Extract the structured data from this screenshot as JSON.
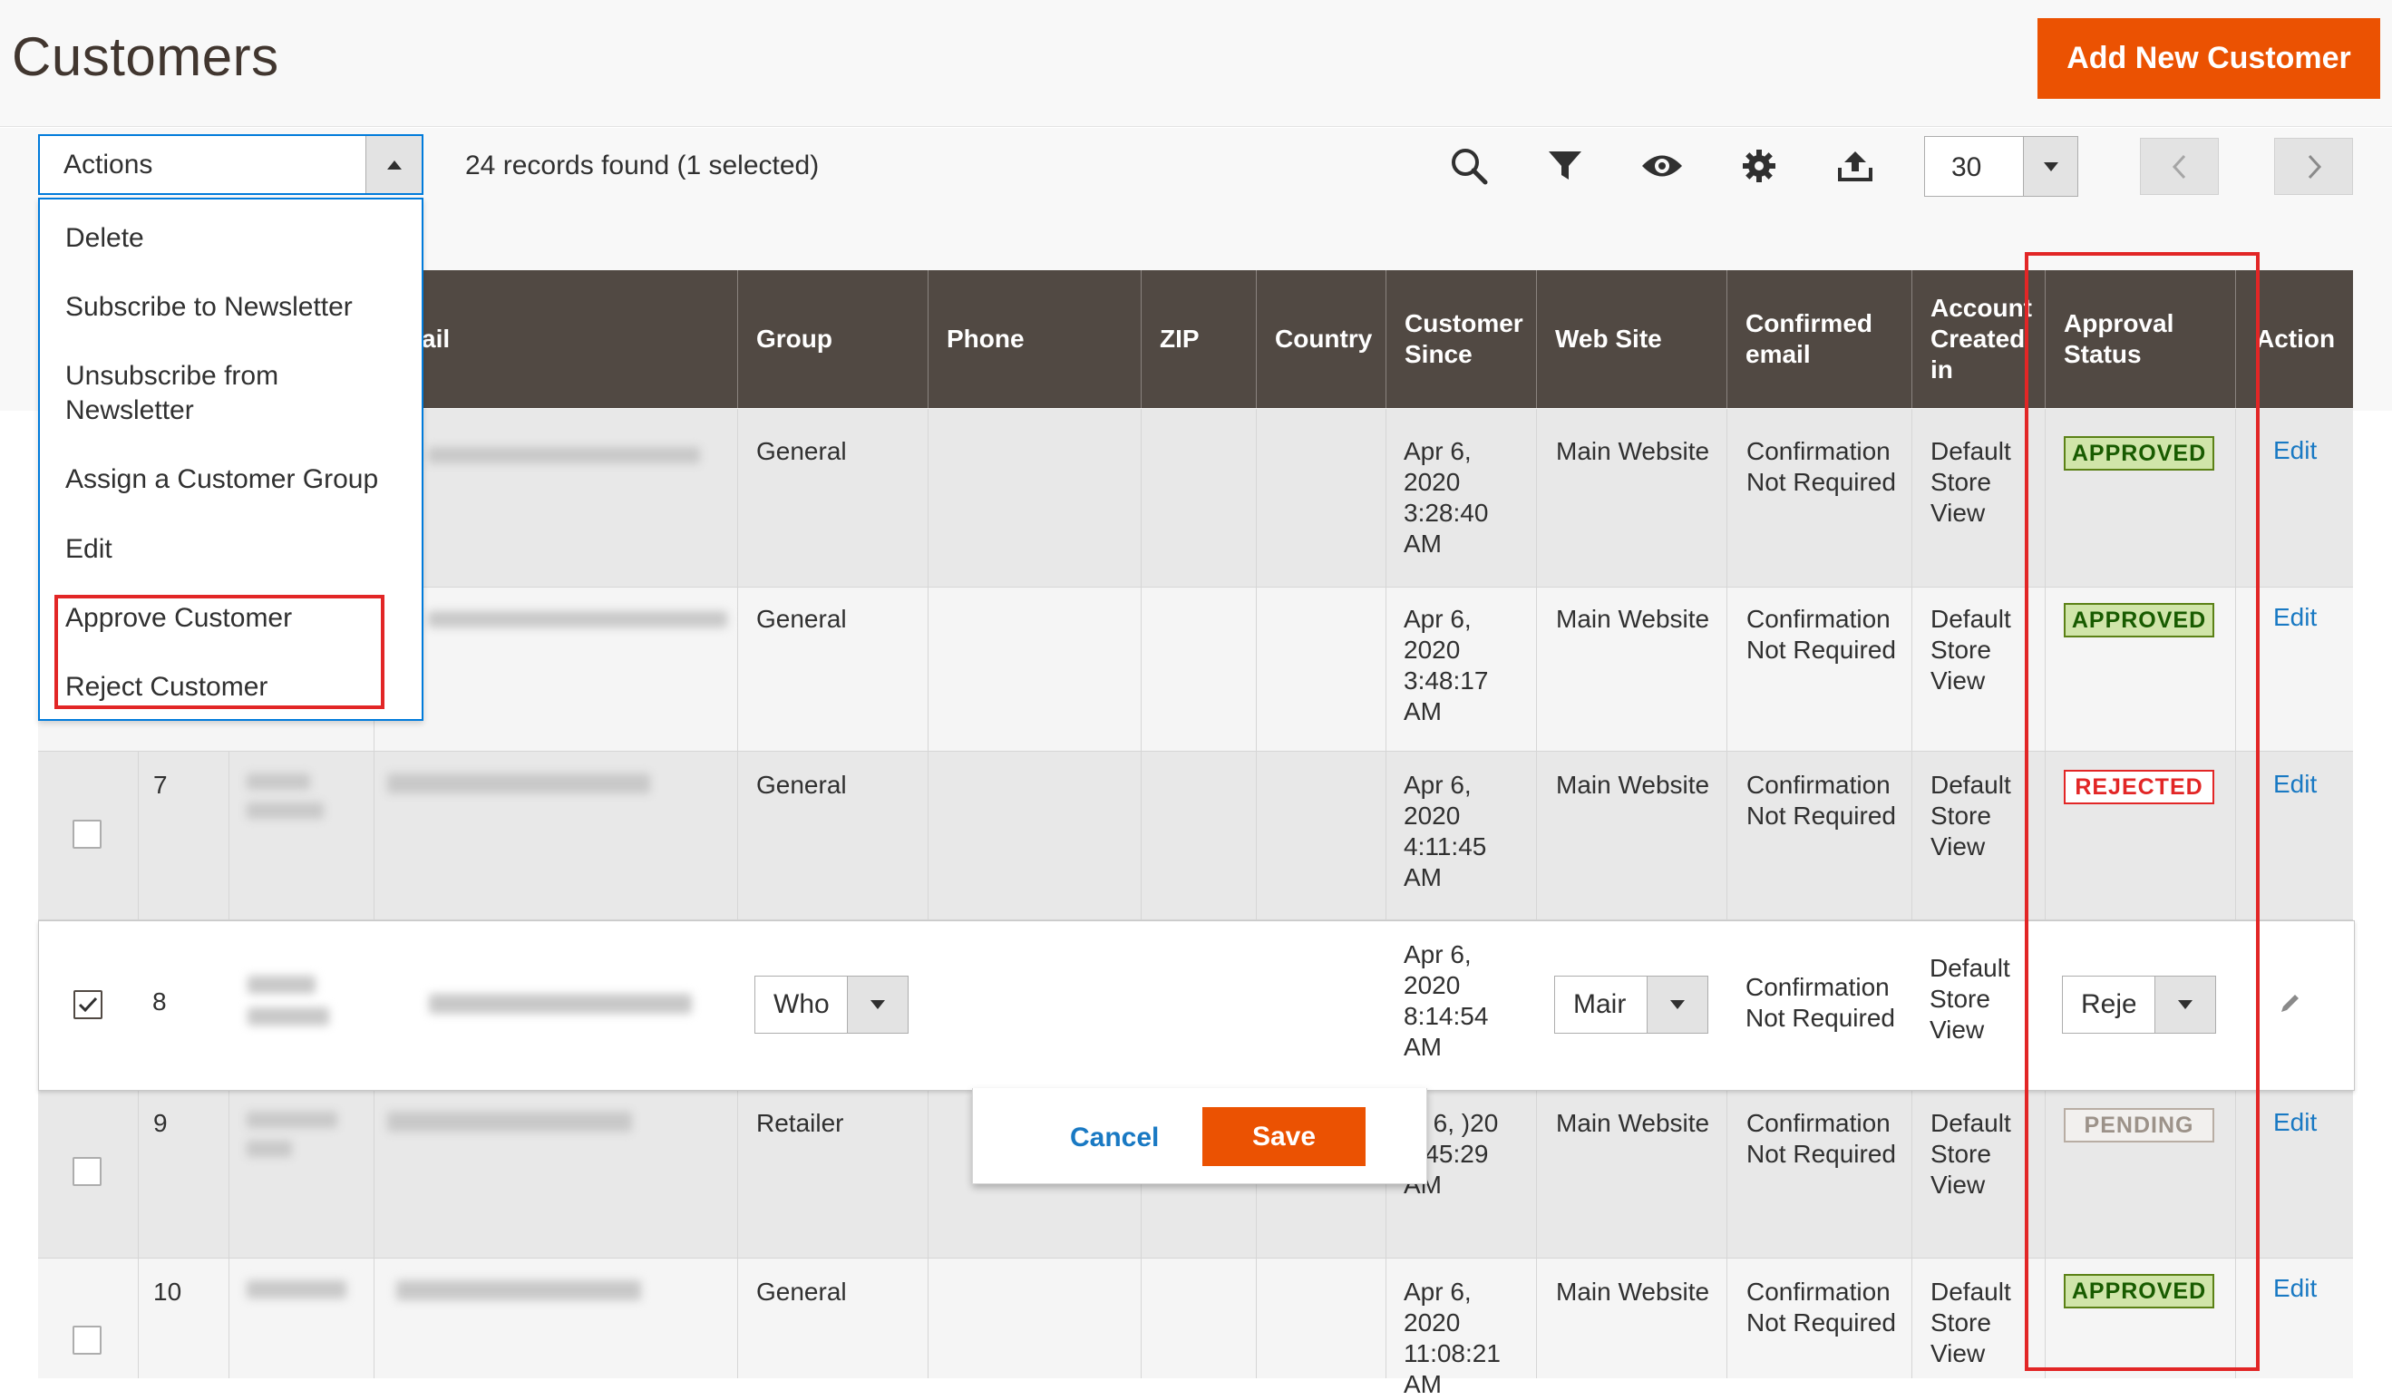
{
  "header": {
    "title": "Customers",
    "add_button": "Add New Customer"
  },
  "toolbar": {
    "actions_label": "Actions",
    "records_text": "24 records found (1 selected)",
    "per_page": "30",
    "icons": [
      "search-icon",
      "filter-icon",
      "eye-icon",
      "gear-icon",
      "export-icon"
    ]
  },
  "actions_menu": {
    "items": [
      "Delete",
      "Subscribe to Newsletter",
      "Unsubscribe from Newsletter",
      "Assign a Customer Group",
      "Edit",
      "Approve Customer",
      "Reject Customer"
    ]
  },
  "grid": {
    "columns": [
      "ail",
      "Group",
      "Phone",
      "ZIP",
      "Country",
      "Customer Since",
      "Web Site",
      "Confirmed email",
      "Account Created in",
      "Approval Status",
      "Action"
    ],
    "rows": [
      {
        "id": "",
        "group": "General",
        "since": "Apr 6, 2020 3:28:40 AM",
        "website": "Main Website",
        "confirmed": "Confirmation Not Required",
        "created_in": "Default Store View",
        "status": "APPROVED",
        "action": "Edit"
      },
      {
        "id": "",
        "group": "General",
        "since": "Apr 6, 2020 3:48:17 AM",
        "website": "Main Website",
        "confirmed": "Confirmation Not Required",
        "created_in": "Default Store View",
        "status": "APPROVED",
        "action": "Edit"
      },
      {
        "id": "7",
        "group": "General",
        "since": "Apr 6, 2020 4:11:45 AM",
        "website": "Main Website",
        "confirmed": "Confirmation Not Required",
        "created_in": "Default Store View",
        "status": "REJECTED",
        "action": "Edit"
      },
      {
        "id": "8",
        "group": "Who",
        "since": "Apr 6, 2020 8:14:54 AM",
        "website": "Mair",
        "confirmed": "Confirmation Not Required",
        "created_in": "Default Store View",
        "status": "Reje",
        "action": ""
      },
      {
        "id": "9",
        "group": "Retailer",
        "since": "pr 6, )20 8:45:29 AM",
        "website": "Main Website",
        "confirmed": "Confirmation Not Required",
        "created_in": "Default Store View",
        "status": "PENDING",
        "action": "Edit"
      },
      {
        "id": "10",
        "group": "General",
        "since": "Apr 6, 2020 11:08:21 AM",
        "website": "Main Website",
        "confirmed": "Confirmation Not Required",
        "created_in": "Default Store View",
        "status": "APPROVED",
        "action": "Edit"
      }
    ]
  },
  "inline_edit": {
    "cancel": "Cancel",
    "save": "Save"
  },
  "colors": {
    "brand_orange": "#eb5202",
    "grid_header": "#514943",
    "link_blue": "#1979c3",
    "highlight_red": "#e22626"
  }
}
